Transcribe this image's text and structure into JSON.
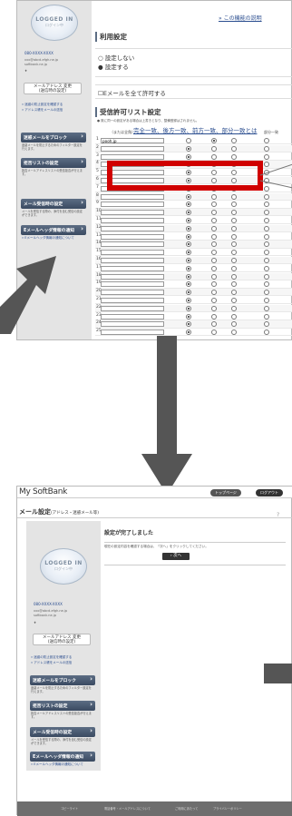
{
  "top_panel": {
    "top_link": "» この機能の説明",
    "section1_title": "利用設定",
    "options": [
      "設定しない",
      "設定する"
    ],
    "checkbox_label": "Eメールを全て許可する",
    "section2_title": "受信許可リスト設定",
    "note": "● 既に同一の設定がある場合は上書きとなり、整備登録はされません。",
    "match_types": "完全一致、後方一致、前方一致、部分一致とは",
    "addr_header": "（または全角）",
    "row_numbers": [
      "1",
      "2",
      "3",
      "4",
      "5",
      "6",
      "7",
      "8",
      "9",
      "10",
      "11",
      "12",
      "13",
      "14",
      "15",
      "16",
      "17",
      "18",
      "19",
      "20",
      "21",
      "22",
      "23",
      "24",
      "25"
    ],
    "first_row_value": "pooh.jp",
    "col_label_4": "部分一致"
  },
  "sidebar": {
    "logo_main": "LOGGED IN",
    "logo_sub": "ログイン中",
    "phone": "080-XXXX-XXXX",
    "mail_lines": [
      "xxx@abcd-efgh.ne.jp",
      "softbank.ne.jp"
    ],
    "addr_button": "メールアドレス 変更\n(送信時の設定)",
    "side_links": [
      "» 迷惑の防止設定を確認する",
      "» アドレス帳をメールの送信"
    ],
    "menu": [
      {
        "head": "迷惑メールをブロック",
        "desc": "迷惑メールを防止するためのフィルター設定を行えます。"
      },
      {
        "head": "拒否リストの設定",
        "desc": "拒否メールアドレスリストの受信拒否が行えます。"
      },
      {
        "head": "メール受信時の設定",
        "desc": "メールを受信する際の、添付を含む受信の設定ができます。"
      },
      {
        "head": "Eメールヘッダ情報の通知",
        "desc": "» Eメールヘッダ情報の通知について"
      }
    ]
  },
  "bottom_panel": {
    "brand": "My SoftBank",
    "nav_buttons": [
      "トップページ",
      "ログアウト"
    ],
    "page_title": "メール設定",
    "page_title_sub": "(アドレス・迷惑メール等)",
    "help_icon": "?",
    "done_title": "設定が完了しました",
    "done_desc": "現在の設定内容を確認する場合は、「次へ」をクリックしてください。",
    "next_button": "› 次へ",
    "footer_links": [
      "コピーライト",
      "電話番号・メールアドレスについて",
      "ご利用にあたって",
      "プライバシーポリシー"
    ]
  },
  "colors": {
    "accent_red": "#d00000",
    "arrow": "#555555",
    "menu_head": "#4a5a70"
  }
}
